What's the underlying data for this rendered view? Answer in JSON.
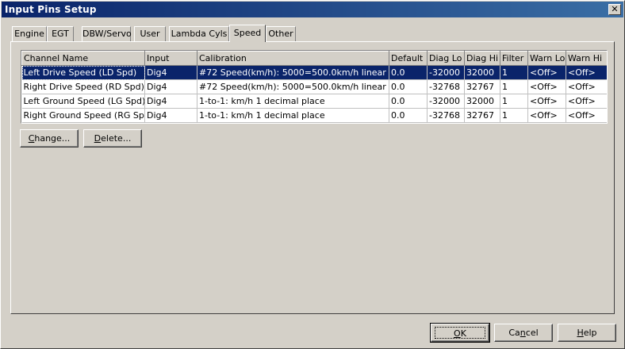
{
  "window": {
    "title": "Input Pins Setup"
  },
  "tabs": [
    {
      "label": "Engine",
      "active": false
    },
    {
      "label": "EGT",
      "active": false
    },
    {
      "label": "DBW/Servo",
      "active": false
    },
    {
      "label": "User",
      "active": false
    },
    {
      "label": "Lambda Cyls",
      "active": false
    },
    {
      "label": "Speed",
      "active": true
    },
    {
      "label": "Other",
      "active": false
    }
  ],
  "table": {
    "columns": [
      "Channel Name",
      "Input",
      "Calibration",
      "Default",
      "Diag Lo",
      "Diag Hi",
      "Filter",
      "Warn Lo",
      "Warn Hi"
    ],
    "rows": [
      [
        "Left Drive Speed  (LD Spd)",
        "Dig4",
        "#72 Speed(km/h): 5000=500.0km/h linear",
        "0.0",
        "-32000",
        "32000",
        "1",
        "<Off>",
        "<Off>"
      ],
      [
        "Right Drive Speed  (RD Spd)",
        "Dig4",
        "#72 Speed(km/h): 5000=500.0km/h linear",
        "0.0",
        "-32768",
        "32767",
        "1",
        "<Off>",
        "<Off>"
      ],
      [
        "Left Ground Speed  (LG Spd)",
        "Dig4",
        "1-to-1: km/h 1 decimal place",
        "0.0",
        "-32000",
        "32000",
        "1",
        "<Off>",
        "<Off>"
      ],
      [
        "Right Ground Speed  (RG Spd)",
        "Dig4",
        "1-to-1: km/h 1 decimal place",
        "0.0",
        "-32768",
        "32767",
        "1",
        "<Off>",
        "<Off>"
      ]
    ],
    "selected_row": 0
  },
  "buttons": {
    "change": {
      "pre": "",
      "key": "C",
      "post": "hange..."
    },
    "delete": {
      "pre": "",
      "key": "D",
      "post": "elete..."
    },
    "ok": {
      "pre": "",
      "key": "O",
      "post": "K"
    },
    "cancel": {
      "pre": "Ca",
      "key": "n",
      "post": "cel"
    },
    "help": {
      "pre": "",
      "key": "H",
      "post": "elp"
    }
  }
}
